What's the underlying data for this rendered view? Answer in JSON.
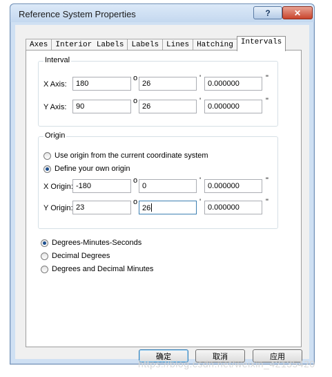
{
  "window": {
    "title": "Reference System Properties",
    "help_glyph": "?",
    "close_glyph": "✕"
  },
  "tabs": [
    {
      "label": "Axes"
    },
    {
      "label": "Interior Labels"
    },
    {
      "label": "Labels"
    },
    {
      "label": "Lines"
    },
    {
      "label": "Hatching"
    },
    {
      "label": "Intervals"
    }
  ],
  "active_tab": "Intervals",
  "interval": {
    "title": "Interval",
    "x_label": "X Axis:",
    "x_deg": "180",
    "x_min": "26",
    "x_sec": "0.000000",
    "y_label": "Y Axis:",
    "y_deg": "90",
    "y_min": "26",
    "y_sec": "0.000000"
  },
  "origin": {
    "title": "Origin",
    "opt_current": "Use origin from the current coordinate system",
    "opt_define": "Define your own origin",
    "selected": "define",
    "x_label": "X Origin:",
    "x_deg": "-180",
    "x_min": "0",
    "x_sec": "0.000000",
    "y_label": "Y Origin:",
    "y_deg": "23",
    "y_min": "26",
    "y_sec": "0.000000"
  },
  "symbols": {
    "degree": "o",
    "minute": "'",
    "second": "\""
  },
  "format": {
    "options": [
      "Degrees-Minutes-Seconds",
      "Decimal Degrees",
      "Degrees and Decimal Minutes"
    ],
    "selected": "Degrees-Minutes-Seconds"
  },
  "buttons": {
    "ok": "确定",
    "cancel": "取消",
    "apply": "应用"
  },
  "watermark": "https://blog.csdn.net/weixin_42135420"
}
